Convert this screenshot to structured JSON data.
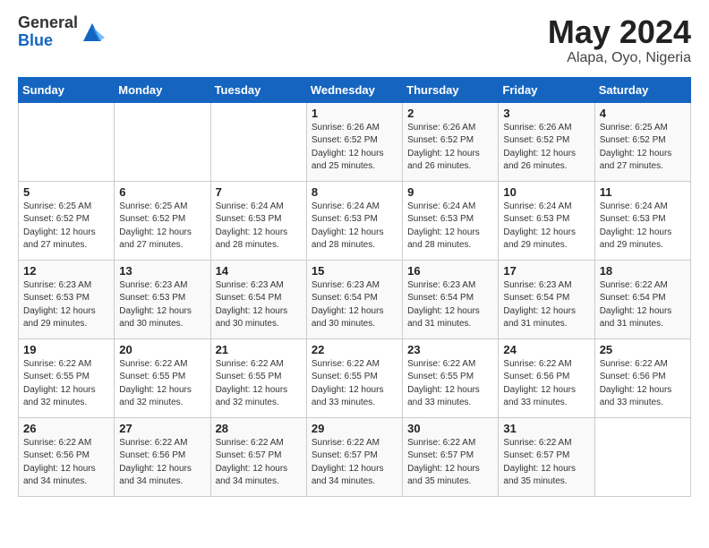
{
  "header": {
    "logo_general": "General",
    "logo_blue": "Blue",
    "title": "May 2024",
    "location": "Alapa, Oyo, Nigeria"
  },
  "days_of_week": [
    "Sunday",
    "Monday",
    "Tuesday",
    "Wednesday",
    "Thursday",
    "Friday",
    "Saturday"
  ],
  "weeks": [
    [
      {
        "day": "",
        "info": ""
      },
      {
        "day": "",
        "info": ""
      },
      {
        "day": "",
        "info": ""
      },
      {
        "day": "1",
        "info": "Sunrise: 6:26 AM\nSunset: 6:52 PM\nDaylight: 12 hours\nand 25 minutes."
      },
      {
        "day": "2",
        "info": "Sunrise: 6:26 AM\nSunset: 6:52 PM\nDaylight: 12 hours\nand 26 minutes."
      },
      {
        "day": "3",
        "info": "Sunrise: 6:26 AM\nSunset: 6:52 PM\nDaylight: 12 hours\nand 26 minutes."
      },
      {
        "day": "4",
        "info": "Sunrise: 6:25 AM\nSunset: 6:52 PM\nDaylight: 12 hours\nand 27 minutes."
      }
    ],
    [
      {
        "day": "5",
        "info": "Sunrise: 6:25 AM\nSunset: 6:52 PM\nDaylight: 12 hours\nand 27 minutes."
      },
      {
        "day": "6",
        "info": "Sunrise: 6:25 AM\nSunset: 6:52 PM\nDaylight: 12 hours\nand 27 minutes."
      },
      {
        "day": "7",
        "info": "Sunrise: 6:24 AM\nSunset: 6:53 PM\nDaylight: 12 hours\nand 28 minutes."
      },
      {
        "day": "8",
        "info": "Sunrise: 6:24 AM\nSunset: 6:53 PM\nDaylight: 12 hours\nand 28 minutes."
      },
      {
        "day": "9",
        "info": "Sunrise: 6:24 AM\nSunset: 6:53 PM\nDaylight: 12 hours\nand 28 minutes."
      },
      {
        "day": "10",
        "info": "Sunrise: 6:24 AM\nSunset: 6:53 PM\nDaylight: 12 hours\nand 29 minutes."
      },
      {
        "day": "11",
        "info": "Sunrise: 6:24 AM\nSunset: 6:53 PM\nDaylight: 12 hours\nand 29 minutes."
      }
    ],
    [
      {
        "day": "12",
        "info": "Sunrise: 6:23 AM\nSunset: 6:53 PM\nDaylight: 12 hours\nand 29 minutes."
      },
      {
        "day": "13",
        "info": "Sunrise: 6:23 AM\nSunset: 6:53 PM\nDaylight: 12 hours\nand 30 minutes."
      },
      {
        "day": "14",
        "info": "Sunrise: 6:23 AM\nSunset: 6:54 PM\nDaylight: 12 hours\nand 30 minutes."
      },
      {
        "day": "15",
        "info": "Sunrise: 6:23 AM\nSunset: 6:54 PM\nDaylight: 12 hours\nand 30 minutes."
      },
      {
        "day": "16",
        "info": "Sunrise: 6:23 AM\nSunset: 6:54 PM\nDaylight: 12 hours\nand 31 minutes."
      },
      {
        "day": "17",
        "info": "Sunrise: 6:23 AM\nSunset: 6:54 PM\nDaylight: 12 hours\nand 31 minutes."
      },
      {
        "day": "18",
        "info": "Sunrise: 6:22 AM\nSunset: 6:54 PM\nDaylight: 12 hours\nand 31 minutes."
      }
    ],
    [
      {
        "day": "19",
        "info": "Sunrise: 6:22 AM\nSunset: 6:55 PM\nDaylight: 12 hours\nand 32 minutes."
      },
      {
        "day": "20",
        "info": "Sunrise: 6:22 AM\nSunset: 6:55 PM\nDaylight: 12 hours\nand 32 minutes."
      },
      {
        "day": "21",
        "info": "Sunrise: 6:22 AM\nSunset: 6:55 PM\nDaylight: 12 hours\nand 32 minutes."
      },
      {
        "day": "22",
        "info": "Sunrise: 6:22 AM\nSunset: 6:55 PM\nDaylight: 12 hours\nand 33 minutes."
      },
      {
        "day": "23",
        "info": "Sunrise: 6:22 AM\nSunset: 6:55 PM\nDaylight: 12 hours\nand 33 minutes."
      },
      {
        "day": "24",
        "info": "Sunrise: 6:22 AM\nSunset: 6:56 PM\nDaylight: 12 hours\nand 33 minutes."
      },
      {
        "day": "25",
        "info": "Sunrise: 6:22 AM\nSunset: 6:56 PM\nDaylight: 12 hours\nand 33 minutes."
      }
    ],
    [
      {
        "day": "26",
        "info": "Sunrise: 6:22 AM\nSunset: 6:56 PM\nDaylight: 12 hours\nand 34 minutes."
      },
      {
        "day": "27",
        "info": "Sunrise: 6:22 AM\nSunset: 6:56 PM\nDaylight: 12 hours\nand 34 minutes."
      },
      {
        "day": "28",
        "info": "Sunrise: 6:22 AM\nSunset: 6:57 PM\nDaylight: 12 hours\nand 34 minutes."
      },
      {
        "day": "29",
        "info": "Sunrise: 6:22 AM\nSunset: 6:57 PM\nDaylight: 12 hours\nand 34 minutes."
      },
      {
        "day": "30",
        "info": "Sunrise: 6:22 AM\nSunset: 6:57 PM\nDaylight: 12 hours\nand 35 minutes."
      },
      {
        "day": "31",
        "info": "Sunrise: 6:22 AM\nSunset: 6:57 PM\nDaylight: 12 hours\nand 35 minutes."
      },
      {
        "day": "",
        "info": ""
      }
    ]
  ]
}
